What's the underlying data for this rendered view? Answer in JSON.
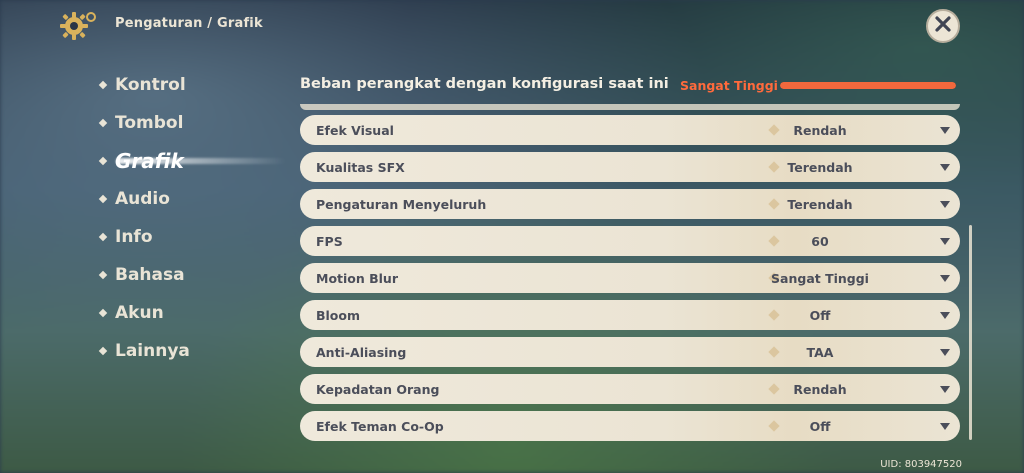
{
  "header": {
    "breadcrumb": "Pengaturan / Grafik",
    "settings_icon": "gear-icon",
    "close_icon": "close-icon"
  },
  "nav": {
    "items": [
      {
        "label": "Kontrol"
      },
      {
        "label": "Tombol"
      },
      {
        "label": "Grafik",
        "active": true
      },
      {
        "label": "Audio"
      },
      {
        "label": "Info"
      },
      {
        "label": "Bahasa"
      },
      {
        "label": "Akun"
      },
      {
        "label": "Lainnya"
      }
    ]
  },
  "device_load": {
    "title": "Beban perangkat dengan konfigurasi saat ini",
    "value": "Sangat Tinggi",
    "color": "#f2683d"
  },
  "settings": [
    {
      "name": "Efek Visual",
      "value": "Rendah"
    },
    {
      "name": "Kualitas SFX",
      "value": "Terendah"
    },
    {
      "name": "Pengaturan Menyeluruh",
      "value": "Terendah"
    },
    {
      "name": "FPS",
      "value": "60"
    },
    {
      "name": "Motion Blur",
      "value": "Sangat Tinggi"
    },
    {
      "name": "Bloom",
      "value": "Off"
    },
    {
      "name": "Anti-Aliasing",
      "value": "TAA"
    },
    {
      "name": "Kepadatan Orang",
      "value": "Rendah"
    },
    {
      "name": "Efek Teman Co-Op",
      "value": "Off"
    }
  ],
  "footer": {
    "uid": "UID: 803947520"
  }
}
